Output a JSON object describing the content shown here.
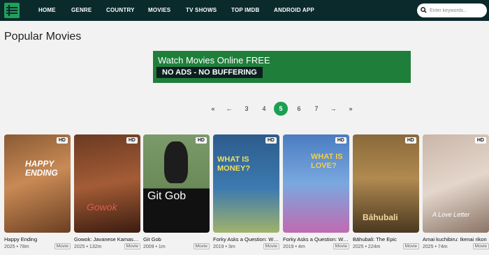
{
  "header": {
    "nav": [
      "HOME",
      "GENRE",
      "COUNTRY",
      "MOVIES",
      "TV SHOWS",
      "TOP IMDB",
      "ANDROID APP"
    ],
    "search_placeholder": "Enter keywords..."
  },
  "page_title": "Popular Movies",
  "banner": {
    "title": "Watch Movies Online FREE",
    "subtitle": "NO ADS - NO BUFFERING"
  },
  "pagination": [
    "«",
    "←",
    "3",
    "4",
    "5",
    "6",
    "7",
    "→",
    "»"
  ],
  "pagination_current": "5",
  "colors": {
    "nav_bg": "#0a2a2c",
    "accent": "#1aa053",
    "banner_bg": "#1f7f3a"
  },
  "movies": [
    {
      "title": "Happy Ending",
      "year": "2025",
      "duration": "78m",
      "type": "Movie",
      "quality": "HD",
      "poster_text": "HAPPY ENDING"
    },
    {
      "title": "Gowok: Javanese Kamasutra",
      "year": "2025",
      "duration": "132m",
      "type": "Movie",
      "quality": "HD",
      "poster_text": "Gowok"
    },
    {
      "title": "Git Gob",
      "year": "2009",
      "duration": "1m",
      "type": "Movie",
      "quality": "HD",
      "poster_text": "Git Gob"
    },
    {
      "title": "Forky Asks a Question: What Is Money?",
      "year": "2019",
      "duration": "3m",
      "type": "Movie",
      "quality": "HD",
      "poster_text": "WHAT IS MONEY?"
    },
    {
      "title": "Forky Asks a Question: What Is Love?",
      "year": "2019",
      "duration": "4m",
      "type": "Movie",
      "quality": "HD",
      "poster_text": "WHAT IS LOVE?"
    },
    {
      "title": "Bāhubali: The Epic",
      "year": "2025",
      "duration": "224m",
      "type": "Movie",
      "quality": "HD",
      "poster_text": "Bāhubali"
    },
    {
      "title": "Amai kuchibiru: Ikenai rikon",
      "year": "2025",
      "duration": "74m",
      "type": "Movie",
      "quality": "HD",
      "poster_text": "A Love Letter"
    }
  ]
}
